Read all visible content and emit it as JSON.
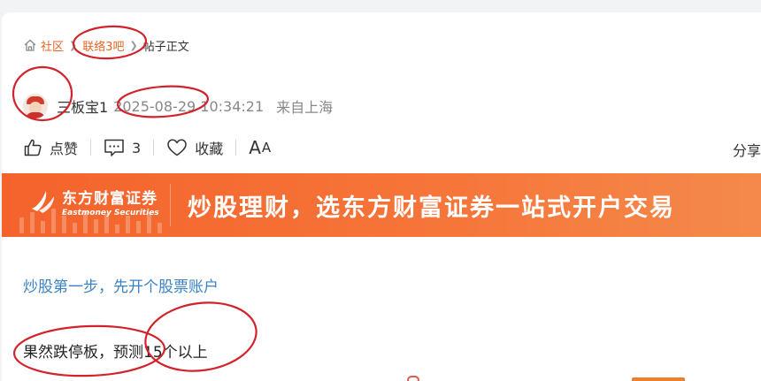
{
  "breadcrumb": {
    "home_icon": "home-icon",
    "community": "社区",
    "bar": "联络3吧",
    "current": "帖子正文"
  },
  "author": {
    "name": "三板宝1",
    "time": "2025-08-29 10:34:21",
    "location": "来自上海"
  },
  "actions": {
    "like": "点赞",
    "comments": "3",
    "favorite": "收藏",
    "font_big": "A",
    "font_small": "A",
    "share": "分享"
  },
  "banner": {
    "brand_cn": "东方财富证券",
    "brand_en": "Eastmoney Securities",
    "slogan": "炒股理财，选东方财富证券一站式开户交易"
  },
  "post": {
    "link_text": "炒股第一步，先开个股票账户",
    "body": "果然跌停板，预测15个以上"
  },
  "colors": {
    "accent": "#e46524",
    "link": "#3b82c4",
    "banner": "#f4632c",
    "annotation": "#d2232a"
  }
}
